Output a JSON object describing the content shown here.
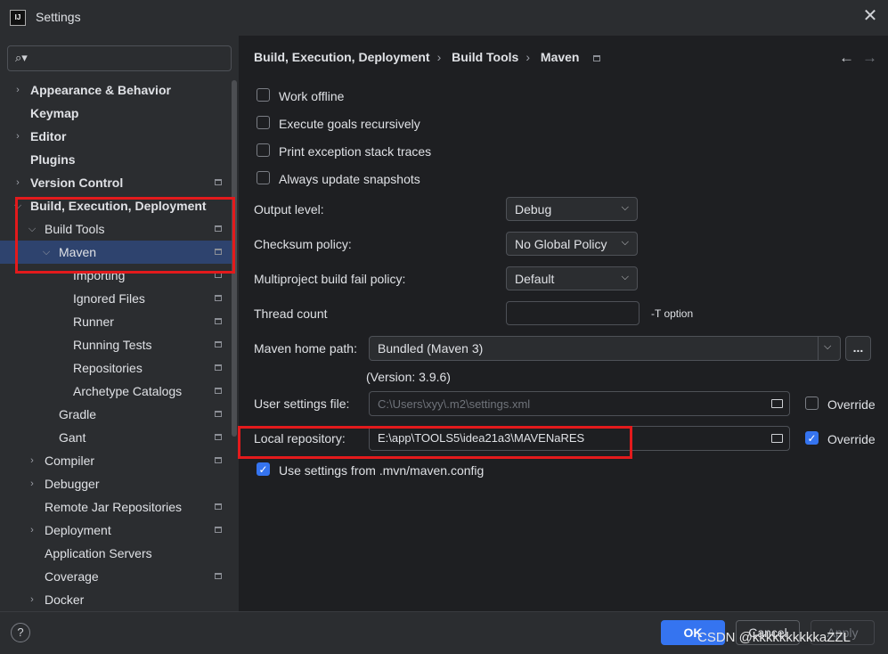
{
  "window": {
    "title": "Settings",
    "app_icon": "IJ"
  },
  "search": {
    "placeholder": ""
  },
  "sidebar": {
    "items": [
      {
        "label": "Appearance & Behavior",
        "level": 0,
        "expand": "collapsed",
        "bold": true,
        "project": false
      },
      {
        "label": "Keymap",
        "level": 0,
        "expand": "none",
        "bold": true,
        "project": false
      },
      {
        "label": "Editor",
        "level": 0,
        "expand": "collapsed",
        "bold": true,
        "project": false
      },
      {
        "label": "Plugins",
        "level": 0,
        "expand": "none",
        "bold": true,
        "project": false
      },
      {
        "label": "Version Control",
        "level": 0,
        "expand": "collapsed",
        "bold": true,
        "project": true
      },
      {
        "label": "Build, Execution, Deployment",
        "level": 0,
        "expand": "expanded",
        "bold": true,
        "project": false
      },
      {
        "label": "Build Tools",
        "level": 1,
        "expand": "expanded",
        "bold": false,
        "project": true
      },
      {
        "label": "Maven",
        "level": 2,
        "expand": "expanded",
        "bold": false,
        "project": true,
        "selected": true
      },
      {
        "label": "Importing",
        "level": 3,
        "expand": "none",
        "bold": false,
        "project": true
      },
      {
        "label": "Ignored Files",
        "level": 3,
        "expand": "none",
        "bold": false,
        "project": true
      },
      {
        "label": "Runner",
        "level": 3,
        "expand": "none",
        "bold": false,
        "project": true
      },
      {
        "label": "Running Tests",
        "level": 3,
        "expand": "none",
        "bold": false,
        "project": true
      },
      {
        "label": "Repositories",
        "level": 3,
        "expand": "none",
        "bold": false,
        "project": true
      },
      {
        "label": "Archetype Catalogs",
        "level": 3,
        "expand": "none",
        "bold": false,
        "project": true
      },
      {
        "label": "Gradle",
        "level": 2,
        "expand": "none",
        "bold": false,
        "project": true
      },
      {
        "label": "Gant",
        "level": 2,
        "expand": "none",
        "bold": false,
        "project": true
      },
      {
        "label": "Compiler",
        "level": 1,
        "expand": "collapsed",
        "bold": false,
        "project": true
      },
      {
        "label": "Debugger",
        "level": 1,
        "expand": "collapsed",
        "bold": false,
        "project": false
      },
      {
        "label": "Remote Jar Repositories",
        "level": 1,
        "expand": "none",
        "bold": false,
        "project": true
      },
      {
        "label": "Deployment",
        "level": 1,
        "expand": "collapsed",
        "bold": false,
        "project": true
      },
      {
        "label": "Application Servers",
        "level": 1,
        "expand": "none",
        "bold": false,
        "project": false
      },
      {
        "label": "Coverage",
        "level": 1,
        "expand": "none",
        "bold": false,
        "project": true
      },
      {
        "label": "Docker",
        "level": 1,
        "expand": "collapsed",
        "bold": false,
        "project": false
      }
    ]
  },
  "breadcrumb": [
    "Build, Execution, Deployment",
    "Build Tools",
    "Maven"
  ],
  "options": {
    "work_offline": "Work offline",
    "execute_goals": "Execute goals recursively",
    "print_exception": "Print exception stack traces",
    "always_update": "Always update snapshots"
  },
  "fields": {
    "output_level": {
      "label": "Output level:",
      "value": "Debug"
    },
    "checksum_policy": {
      "label": "Checksum policy:",
      "value": "No Global Policy"
    },
    "multiproject_policy": {
      "label": "Multiproject build fail policy:",
      "value": "Default"
    },
    "thread_count": {
      "label": "Thread count",
      "value": "",
      "suffix": "-T option"
    },
    "maven_home": {
      "label": "Maven home path:",
      "value": "Bundled (Maven 3)",
      "more": "...",
      "version": "(Version: 3.9.6)"
    },
    "user_settings": {
      "label": "User settings file:",
      "value": "C:\\Users\\xyy\\.m2\\settings.xml",
      "override_label": "Override"
    },
    "local_repo": {
      "label": "Local repository:",
      "value": "E:\\app\\TOOLS5\\idea21a3\\MAVENaRES",
      "override_label": "Override"
    },
    "use_mvn_config": "Use settings from .mvn/maven.config"
  },
  "footer": {
    "help": "?",
    "ok": "OK",
    "cancel": "Cancel",
    "apply": "Apply",
    "watermark": "CSDN @kkkkkkkkkkaZZL"
  },
  "colors": {
    "accent": "#3574f0",
    "selection": "#2e436e",
    "annotation": "#e31a1c"
  }
}
